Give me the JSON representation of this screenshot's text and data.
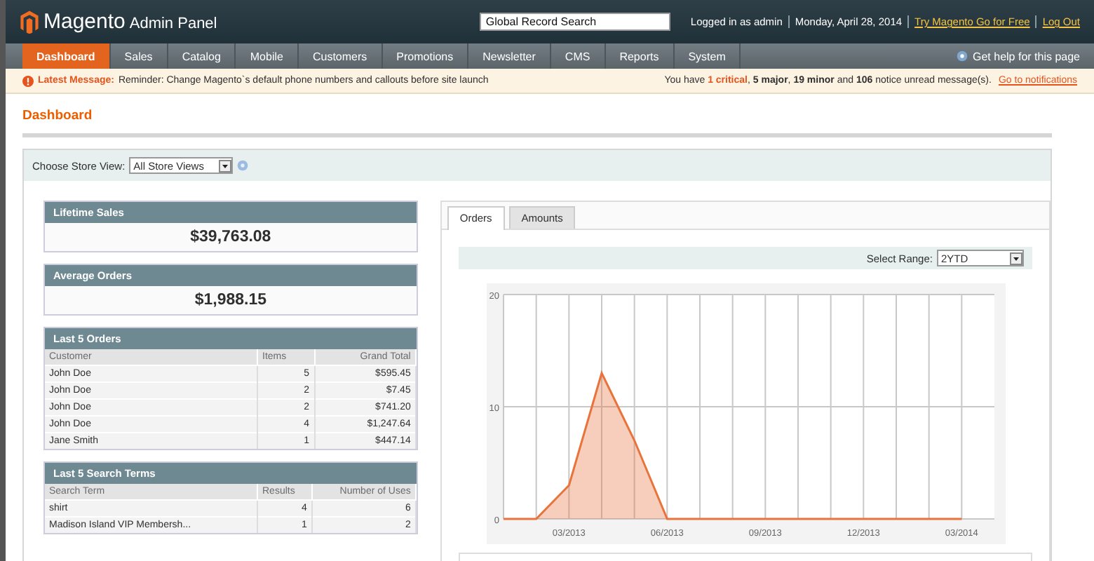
{
  "header": {
    "logo": "Magento",
    "logo_suffix": "Admin Panel",
    "search": {
      "placeholder": "Global Record Search"
    },
    "user": "Logged in as admin",
    "date": "Monday, April 28, 2014",
    "links": [
      "Try Magento Go for Free",
      "Log Out"
    ]
  },
  "nav": {
    "items": [
      {
        "label": "Dashboard",
        "selected": true
      },
      {
        "label": "Sales",
        "selected": false
      },
      {
        "label": "Catalog",
        "selected": false
      },
      {
        "label": "Mobile",
        "selected": false
      },
      {
        "label": "Customers",
        "selected": false
      },
      {
        "label": "Promotions",
        "selected": false
      },
      {
        "label": "Newsletter",
        "selected": false
      },
      {
        "label": "CMS",
        "selected": false
      },
      {
        "label": "Reports",
        "selected": false
      },
      {
        "label": "System",
        "selected": false
      }
    ],
    "help": "Get help for this page"
  },
  "message_bar": {
    "label": "Latest Message:",
    "text": "Reminder: Change Magento`s default phone numbers and callouts before site launch",
    "summary": "You have **1 critical**, **5 major**, **19 minor** and **106** notice unread message(s).",
    "link": "Go to notifications"
  },
  "page_title": "Dashboard",
  "store_switcher": {
    "label": "Choose Store View:",
    "value": "All Store Views"
  },
  "stats": [
    {
      "title": "Lifetime Sales",
      "value": "$39,763.08"
    },
    {
      "title": "Average Orders",
      "value": "$1,988.15"
    }
  ],
  "tables": [
    {
      "title": "Last 5 Orders",
      "columns": [
        "Customer",
        "Items",
        "Grand Total"
      ],
      "rows": [
        [
          "John Doe",
          "5",
          "$595.45"
        ],
        [
          "John Doe",
          "2",
          "$7.45"
        ],
        [
          "John Doe",
          "2",
          "$741.20"
        ],
        [
          "John Doe",
          "4",
          "$1,247.64"
        ],
        [
          "Jane Smith",
          "1",
          "$447.14"
        ]
      ]
    },
    {
      "title": "Last 5 Search Terms",
      "columns": [
        "Search Term",
        "Results",
        "Number of Uses"
      ],
      "rows": [
        [
          "shirt",
          "4",
          "6"
        ],
        [
          "Madison Island VIP Membersh...",
          "1",
          "2"
        ]
      ]
    }
  ],
  "chart_panel": {
    "tabs": [
      {
        "label": "Orders",
        "selected": true
      },
      {
        "label": "Amounts",
        "selected": false
      }
    ],
    "range_label": "Select Range:",
    "range_value": "2YTD",
    "chart_data": {
      "type": "area",
      "categories": [
        null,
        null,
        "03/2013",
        null,
        null,
        "06/2013",
        null,
        null,
        "09/2013",
        null,
        null,
        "12/2013",
        null,
        null,
        "03/2014"
      ],
      "grid": true,
      "series": [
        {
          "color": "#e8743b",
          "values": [
            0,
            0,
            3,
            13,
            7,
            0,
            0,
            0,
            0,
            0,
            0,
            0,
            0,
            0,
            0
          ]
        }
      ],
      "ylim": [
        0,
        20
      ],
      "yticks": [
        0,
        10,
        20
      ]
    }
  }
}
